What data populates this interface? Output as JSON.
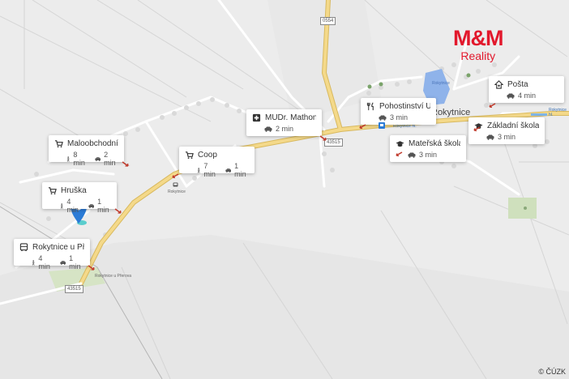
{
  "brand": {
    "logo_text": "M&M",
    "logo_sub": "Reality"
  },
  "copyright": "© ČÚZK",
  "map_labels": {
    "road_top": "0554",
    "road_mid": "43515",
    "road_bottom": "43515",
    "town": "Rokytnice",
    "place_rokytnice": "Rokytnice",
    "place_rokytnice_prerov": "Rokytnice u Přerova",
    "place_lake": "Rokytnice",
    "place_station": "Rokytnice hl.",
    "place_east": "Rokytnice hl."
  },
  "pois": [
    {
      "id": "maloobchod",
      "icon": "cart-icon",
      "name": "Maloobchodní Sít...",
      "walk": "8 min",
      "car": "2 min"
    },
    {
      "id": "hruska",
      "icon": "cart-icon",
      "name": "Hruška",
      "walk": "4 min",
      "car": "1 min"
    },
    {
      "id": "coop",
      "icon": "cart-icon",
      "name": "Coop",
      "walk": "7 min",
      "car": "1 min"
    },
    {
      "id": "mudr",
      "icon": "medical-cross-icon",
      "name": "MUDr. Mathonov...",
      "walk": null,
      "car": "2 min"
    },
    {
      "id": "pohostinstvi",
      "icon": "fork-knife-icon",
      "name": "Pohostinství U He...",
      "walk": null,
      "car": "3 min"
    },
    {
      "id": "materska",
      "icon": "graduation-cap-icon",
      "name": "Mateřská škola",
      "walk": null,
      "car": "3 min"
    },
    {
      "id": "zakladni",
      "icon": "graduation-cap-icon",
      "name": "Základní škola Ro...",
      "walk": null,
      "car": "3 min"
    },
    {
      "id": "posta",
      "icon": "post-office-icon",
      "name": "Pošta",
      "walk": null,
      "car": "4 min"
    },
    {
      "id": "rokytnice_bus",
      "icon": "bus-icon",
      "name": "Rokytnice u Přero...",
      "walk": "4 min",
      "car": "1 min"
    }
  ],
  "colors": {
    "accent": "#e2182c",
    "marker": "#2b7bd6",
    "road": "#f4d98a",
    "water": "#8fb3ea",
    "green": "#cfe0bd"
  }
}
